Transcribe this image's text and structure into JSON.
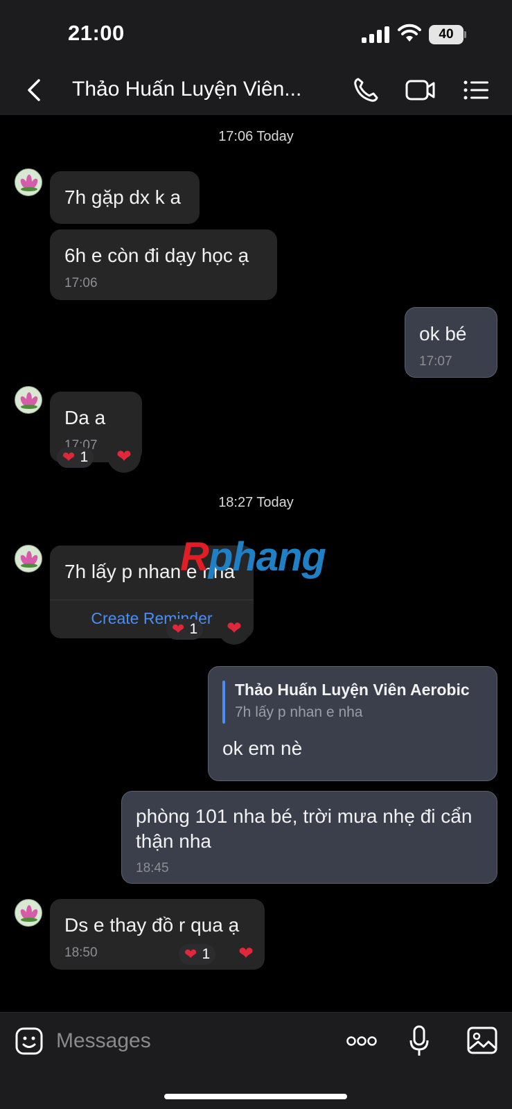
{
  "status": {
    "time": "21:00",
    "battery": "40"
  },
  "header": {
    "title": "Thảo Huấn Luyện Viên..."
  },
  "timestamps": [
    "17:06 Today",
    "18:27 Today"
  ],
  "messages": [
    {
      "text": "7h gặp dx k a"
    },
    {
      "text": "6h e còn đi dạy học ạ",
      "time": "17:06"
    },
    {
      "text": "ok bé",
      "time": "17:07"
    },
    {
      "text": "Da a",
      "time": "17:07",
      "reaction_count": "1"
    },
    {
      "text": "7h lấy p nhan e nha",
      "action": "Create Reminder",
      "reaction_count": "1"
    },
    {
      "quote_name": "Thảo Huấn Luyện Viên Aerobic",
      "quote_text": "7h lấy p nhan e nha",
      "text": "ok em nè"
    },
    {
      "text": "phòng 101 nha bé, trời mưa nhẹ đi cẩn thận nha",
      "time": "18:45"
    },
    {
      "text": "Ds e thay đồ r qua ạ",
      "time": "18:50",
      "reaction_count": "1"
    }
  ],
  "watermark": {
    "first": "R",
    "rest": "phang"
  },
  "composer": {
    "placeholder": "Messages"
  },
  "icons": [
    "signal-icon",
    "wifi-icon",
    "back-icon",
    "phone-icon",
    "video-icon",
    "menu-list-icon",
    "heart-icon",
    "sticker-icon",
    "more-icon",
    "microphone-icon",
    "image-icon"
  ],
  "colors": {
    "background": "#000000",
    "incoming": "#262626",
    "outgoing": "#3a3f4b",
    "accent": "#4b8ef2",
    "heart": "#e0283a"
  }
}
